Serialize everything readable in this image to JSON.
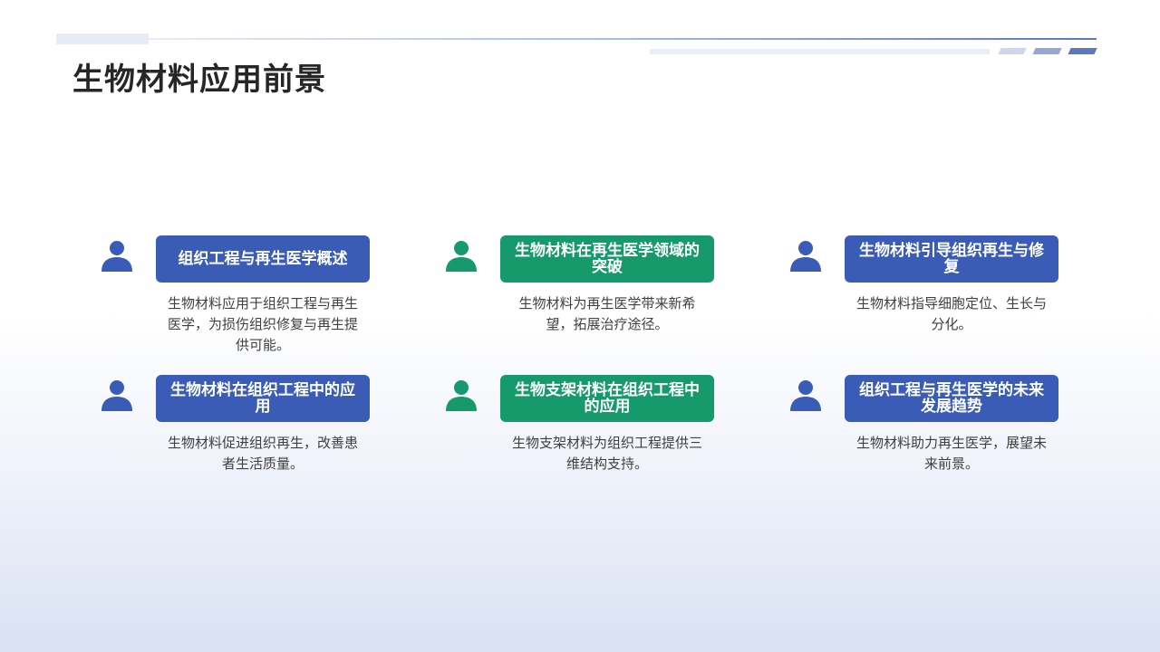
{
  "page": {
    "title": "生物材料应用前景"
  },
  "colors": {
    "blue": "#3a5cb7",
    "green": "#16996b"
  },
  "cards": [
    {
      "icon": "person-icon",
      "color": "blue",
      "title": "组织工程与再生医学概述",
      "desc": "生物材料应用于组织工程与再生医学，为损伤组织修复与再生提供可能。"
    },
    {
      "icon": "person-icon",
      "color": "green",
      "title": "生物材料在再生医学领域的突破",
      "desc": "生物材料为再生医学带来新希望，拓展治疗途径。"
    },
    {
      "icon": "person-icon",
      "color": "blue",
      "title": "生物材料引导组织再生与修复",
      "desc": "生物材料指导细胞定位、生长与分化。"
    },
    {
      "icon": "person-icon",
      "color": "blue",
      "title": "生物材料在组织工程中的应用",
      "desc": "生物材料促进组织再生，改善患者生活质量。"
    },
    {
      "icon": "person-icon",
      "color": "green",
      "title": "生物支架材料在组织工程中的应用",
      "desc": "生物支架材料为组织工程提供三维结构支持。"
    },
    {
      "icon": "person-icon",
      "color": "blue",
      "title": "组织工程与再生医学的未来发展趋势",
      "desc": "生物材料助力再生医学，展望未来前景。"
    }
  ]
}
